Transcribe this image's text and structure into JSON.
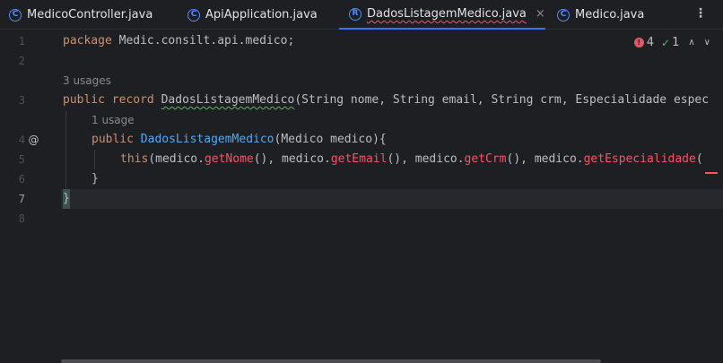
{
  "tabs": [
    {
      "label": "MedicoController.java",
      "icon": "C"
    },
    {
      "label": "ApiApplication.java",
      "icon": "C"
    },
    {
      "label": "DadosListagemMedico.java",
      "icon": "R",
      "active": true,
      "close": "×"
    },
    {
      "label": "Medico.java",
      "icon": "C"
    }
  ],
  "menu_glyph": "⋮",
  "inspection": {
    "errors": "4",
    "ok": "1",
    "up": "∧",
    "down": "∨"
  },
  "lines": {
    "n1": "1",
    "n2": "2",
    "n3": "3",
    "n4": "4",
    "n5": "5",
    "n6": "6",
    "n7": "7",
    "n8": "8"
  },
  "code": {
    "l1_kw": "package",
    "l1_rest": " Medic.consilt.api.medico;",
    "hint3": "3 usages",
    "l3_kw1": "public",
    "l3_kw2": "record",
    "l3_name": "DadosListagemMedico",
    "l3_rest": "(String nome, String email, String crm, Especialidade espec",
    "hint4": "1 usage",
    "l4_kw": "public",
    "l4_ctor": "DadosListagemMedico",
    "l4_rest": "(Medico medico){",
    "l5_kw": "this",
    "l5_a": "(medico.",
    "l5_m1": "getNome",
    "l5_b": "(), medico.",
    "l5_m2": "getEmail",
    "l5_c": "(), medico.",
    "l5_m3": "getCrm",
    "l5_d": "(), medico.",
    "l5_m4": "getEspecialidade",
    "l5_e": "(",
    "l6": "}",
    "l7": "}"
  },
  "gutter_icon": "@",
  "colors": {
    "accent": "#3574f0",
    "error": "#f75464",
    "keyword": "#cf8e6d",
    "ctor": "#56a8f5"
  }
}
